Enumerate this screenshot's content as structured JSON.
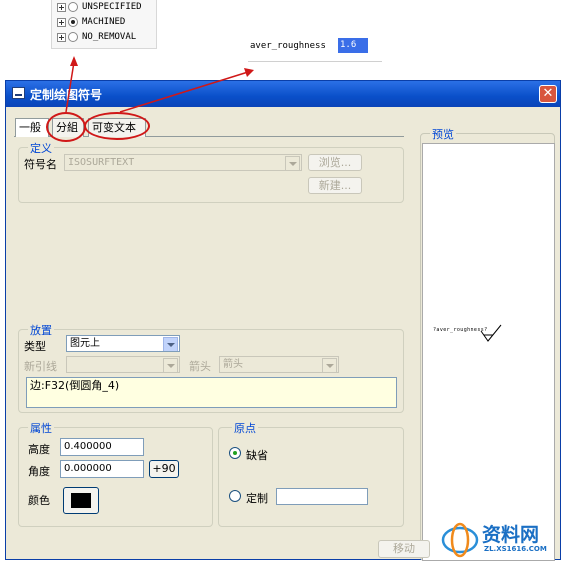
{
  "tree_callout": {
    "items": [
      {
        "label": "UNSPECIFIED",
        "selected": false
      },
      {
        "label": "MACHINED",
        "selected": true
      },
      {
        "label": "NO_REMOVAL",
        "selected": false
      }
    ]
  },
  "variable_callout": {
    "label": "aver_roughness",
    "value": "1.6"
  },
  "window": {
    "title": "定制绘图符号",
    "close_glyph": "✕"
  },
  "tabs": [
    {
      "label": "一般",
      "active": true
    },
    {
      "label": "分組",
      "active": false
    },
    {
      "label": "可变文本",
      "active": false
    }
  ],
  "definition": {
    "title": "定义",
    "symbol_name_label": "符号名",
    "symbol_name_value": "ISOSURFTEXT",
    "browse_label": "浏览...",
    "new_label": "新建..."
  },
  "placement": {
    "title": "放置",
    "type_label": "类型",
    "type_value": "图元上",
    "leader_label": "新引线",
    "leader_value": "",
    "arrow_label": "箭头",
    "arrow_value": "箭头",
    "reference_text": "边:F32(倒圆角_4)"
  },
  "attributes": {
    "title": "属性",
    "height_label": "高度",
    "height_value": "0.400000",
    "angle_label": "角度",
    "angle_value": "0.000000",
    "rotate_label": "+90",
    "color_label": "颜色",
    "color_swatch": "#000000"
  },
  "origin": {
    "title": "原点",
    "default_label": "缺省",
    "default_selected": true,
    "custom_label": "定制",
    "custom_value": ""
  },
  "preview": {
    "title": "预览",
    "symbol_text": "?aver_roughness?"
  },
  "footer": {
    "move_label": "移动"
  },
  "watermark": {
    "name": "资料网",
    "url": "ZL.XS1616.COM"
  },
  "colors": {
    "callout_red": "#d01818",
    "title_blue": "#0a4fc9",
    "group_title": "#0046d5",
    "dialog_bg": "#ece9d8"
  }
}
